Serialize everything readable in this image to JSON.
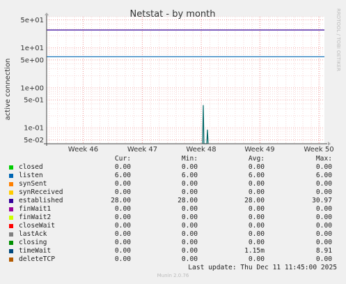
{
  "chart_data": {
    "type": "line",
    "title": "Netstat - by month",
    "ylabel": "active connection",
    "yscale": "log",
    "ylim": [
      0.04,
      60
    ],
    "yticks": [
      "5e+01",
      "1e+01",
      "5e+00",
      "1e+00",
      "5e-01",
      "1e-01",
      "5e-02"
    ],
    "xticks": [
      "Week 46",
      "Week 47",
      "Week 48",
      "Week 49",
      "Week 50"
    ],
    "series": [
      {
        "name": "established",
        "color": "#330099",
        "values": [
          {
            "x": "start",
            "y": 28
          },
          {
            "x": "end",
            "y": 28
          }
        ]
      },
      {
        "name": "listen",
        "color": "#0066b3",
        "values": [
          {
            "x": "start",
            "y": 6
          },
          {
            "x": "end",
            "y": 6
          }
        ]
      },
      {
        "name": "timeWait",
        "color": "#006666",
        "values": [
          {
            "x": "Week 48",
            "y": 0.37
          },
          {
            "x": "Week 48",
            "y": 0.09
          }
        ]
      }
    ]
  },
  "side_label": "RRDTOOL / TOBI OETIKER",
  "legend": {
    "headers": {
      "cur": "Cur:",
      "min": "Min:",
      "avg": "Avg:",
      "max": "Max:"
    },
    "rows": [
      {
        "name": "closed",
        "color": "#00cc00",
        "cur": "0.00",
        "min": "0.00",
        "avg": "0.00",
        "max": "0.00"
      },
      {
        "name": "listen",
        "color": "#0066b3",
        "cur": "6.00",
        "min": "6.00",
        "avg": "6.00",
        "max": "6.00"
      },
      {
        "name": "synSent",
        "color": "#ff8000",
        "cur": "0.00",
        "min": "0.00",
        "avg": "0.00",
        "max": "0.00"
      },
      {
        "name": "synReceived",
        "color": "#ffcc00",
        "cur": "0.00",
        "min": "0.00",
        "avg": "0.00",
        "max": "0.00"
      },
      {
        "name": "established",
        "color": "#330099",
        "cur": "28.00",
        "min": "28.00",
        "avg": "28.00",
        "max": "30.97"
      },
      {
        "name": "finWait1",
        "color": "#990099",
        "cur": "0.00",
        "min": "0.00",
        "avg": "0.00",
        "max": "0.00"
      },
      {
        "name": "finWait2",
        "color": "#ccff00",
        "cur": "0.00",
        "min": "0.00",
        "avg": "0.00",
        "max": "0.00"
      },
      {
        "name": "closeWait",
        "color": "#ff0000",
        "cur": "0.00",
        "min": "0.00",
        "avg": "0.00",
        "max": "0.00"
      },
      {
        "name": "lastAck",
        "color": "#808080",
        "cur": "0.00",
        "min": "0.00",
        "avg": "0.00",
        "max": "0.00"
      },
      {
        "name": "closing",
        "color": "#008f00",
        "cur": "0.00",
        "min": "0.00",
        "avg": "0.00",
        "max": "0.00"
      },
      {
        "name": "timeWait",
        "color": "#00487d",
        "cur": "0.00",
        "min": "0.00",
        "avg": "1.15m",
        "max": "8.91"
      },
      {
        "name": "deleteTCP",
        "color": "#b35a00",
        "cur": "0.00",
        "min": "0.00",
        "avg": "0.00",
        "max": "0.00"
      }
    ]
  },
  "last_update": "Last update: Thu Dec 11 11:45:00 2025",
  "footer": "Munin 2.0.76"
}
